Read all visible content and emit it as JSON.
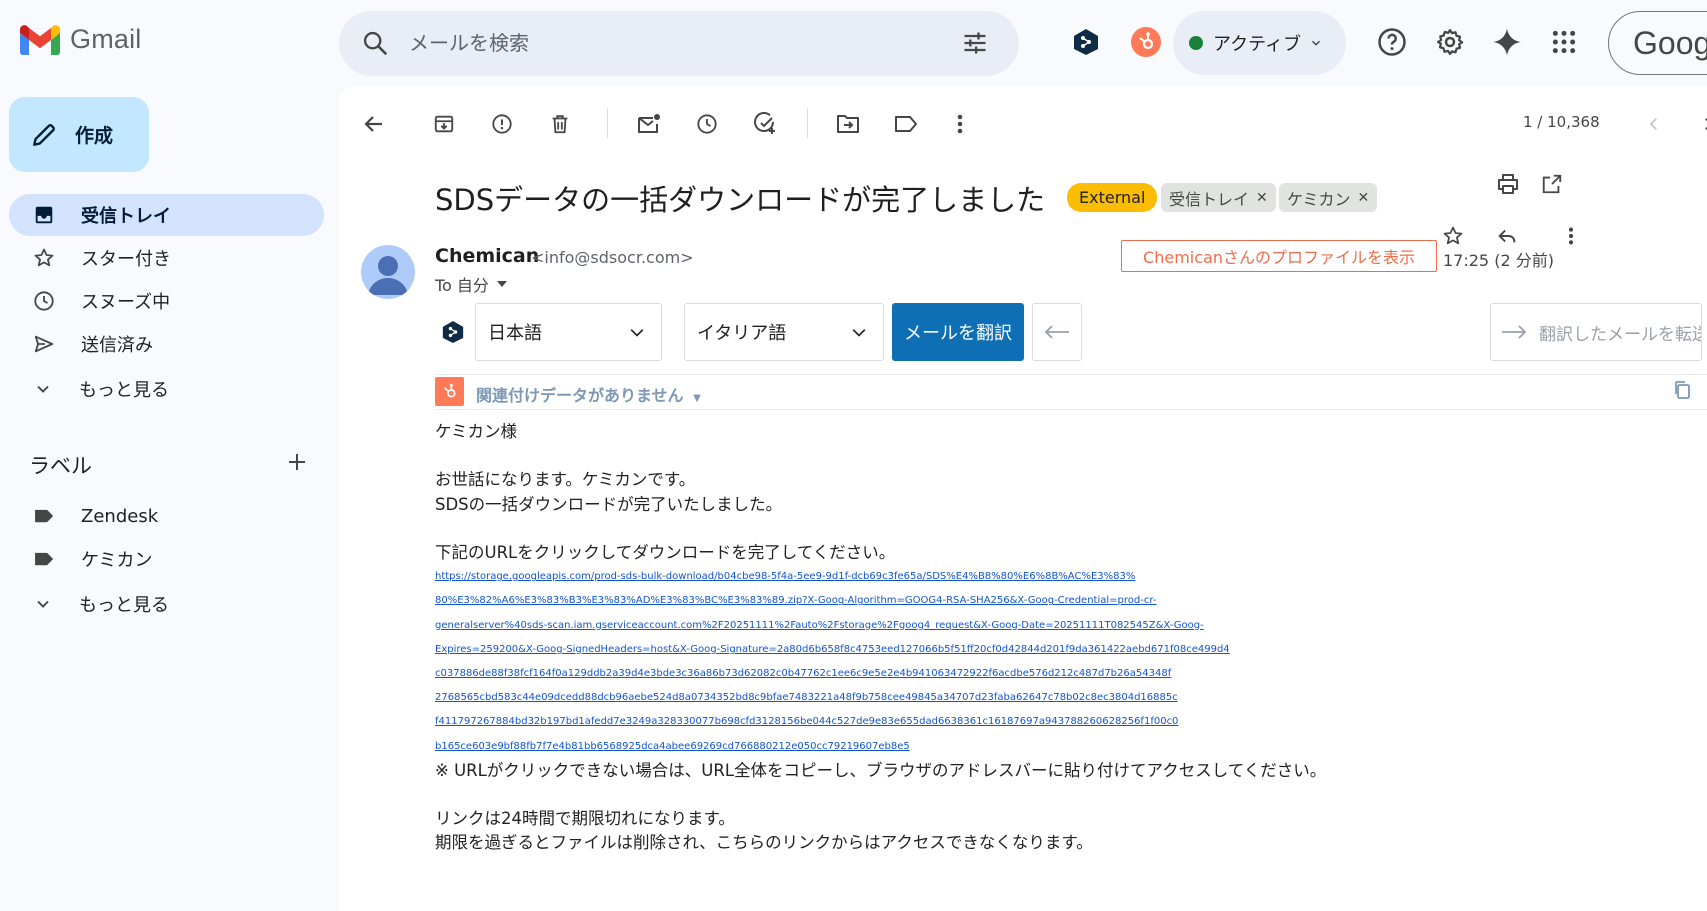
{
  "header": {
    "app_name": "Gmail",
    "search_placeholder": "メールを検索",
    "status_label": "アクティブ",
    "account_label": "Goog"
  },
  "sidebar": {
    "compose_label": "作成",
    "items": [
      {
        "label": "受信トレイ",
        "icon": "inbox-icon",
        "active": true
      },
      {
        "label": "スター付き",
        "icon": "star-icon"
      },
      {
        "label": "スヌーズ中",
        "icon": "clock-icon"
      },
      {
        "label": "送信済み",
        "icon": "send-icon"
      },
      {
        "label": "もっと見る",
        "icon": "chevron-down-icon"
      }
    ],
    "labels_heading": "ラベル",
    "labels": [
      {
        "label": "Zendesk",
        "icon": "label-icon"
      },
      {
        "label": "ケミカン",
        "icon": "label-icon"
      },
      {
        "label": "もっと見る",
        "icon": "chevron-down-icon"
      }
    ]
  },
  "toolbar": {
    "pager": "1 / 10,368"
  },
  "email": {
    "subject": "SDSデータの一括ダウンロードが完了しました",
    "chips": {
      "external": "External",
      "inbox": "受信トレイ",
      "kemikan": "ケミカン"
    },
    "sender_name": "Chemican",
    "sender_email": "<info@sdsocr.com>",
    "to_line": "To 自分",
    "profile_link": "Chemicanさんのプロファイルを表示",
    "time": "17:25 (2 分前)",
    "translate": {
      "source_lang": "日本語",
      "target_lang": "イタリア語",
      "translate_button": "メールを翻訳",
      "forward_translated": "翻訳したメールを転送"
    },
    "hubspot_text": "関連付けデータがありません",
    "body": {
      "greeting": "ケミカン様",
      "line1": "お世話になります。ケミカンです。",
      "line2": "SDSの一括ダウンロードが完了いたしました。",
      "line3": "下記のURLをクリックしてダウンロードを完了してください。",
      "url_lines": [
        "https://storage.googleapis.com/prod-sds-bulk-download/b04cbe98-5f4a-5ee9-9d1f-dcb69c3fe65a/SDS%E4%B8%80%E6%8B%AC%E3%83%",
        "80%E3%82%A6%E3%83%B3%E3%83%AD%E3%83%BC%E3%83%89.zip?X-Goog-Algorithm=GOOG4-RSA-SHA256&X-Goog-Credential=prod-cr-",
        "generalserver%40sds-scan.iam.gserviceaccount.com%2F20251111%2Fauto%2Fstorage%2Fgoog4_request&X-Goog-Date=20251111T082545Z&X-Goog-",
        "Expires=259200&X-Goog-SignedHeaders=host&X-Goog-Signature=2a80d6b658f8c4753eed127066b5f51ff20cf0d42844d201f9da361422aebd671f08ce499d4",
        "c037886de88f38fcf164f0a129ddb2a39d4e3bde3c36a86b73d62082c0b47762c1ee6c9e5e2e4b941063472922f6acdbe576d212c487d7b26a54348f",
        "2768565cbd583c44e09dcedd88dcb96aebe524d8a0734352bd8c9bfae7483221a48f9b758cee49845a34707d23faba62647c78b02c8ec3804d16885c",
        "f411797267884bd32b197bd1afedd7e3249a328330077b698cfd3128156be044c527de9e83e655dad6638361c16187697a943788260628256f1f00c0",
        "b165ce603e9bf88fb7f7e4b81bb6568925dca4abee69269cd766880212e050cc79219607eb8e5"
      ],
      "note": "※ URLがクリックできない場合は、URL全体をコピーし、ブラウザのアドレスバーに貼り付けてアクセスしてください。",
      "expiry1": "リンクは24時間で期限切れになります。",
      "expiry2": "期限を過ぎるとファイルは削除され、こちらのリンクからはアクセスできなくなります。"
    }
  },
  "colors": {
    "compose_bg": "#c2e7ff",
    "active_nav_bg": "#d3e3fd",
    "external_chip": "#fbbc04",
    "translate_button": "#0f6fb5",
    "hubspot_orange": "#ff7a59",
    "link": "#1155cc"
  }
}
